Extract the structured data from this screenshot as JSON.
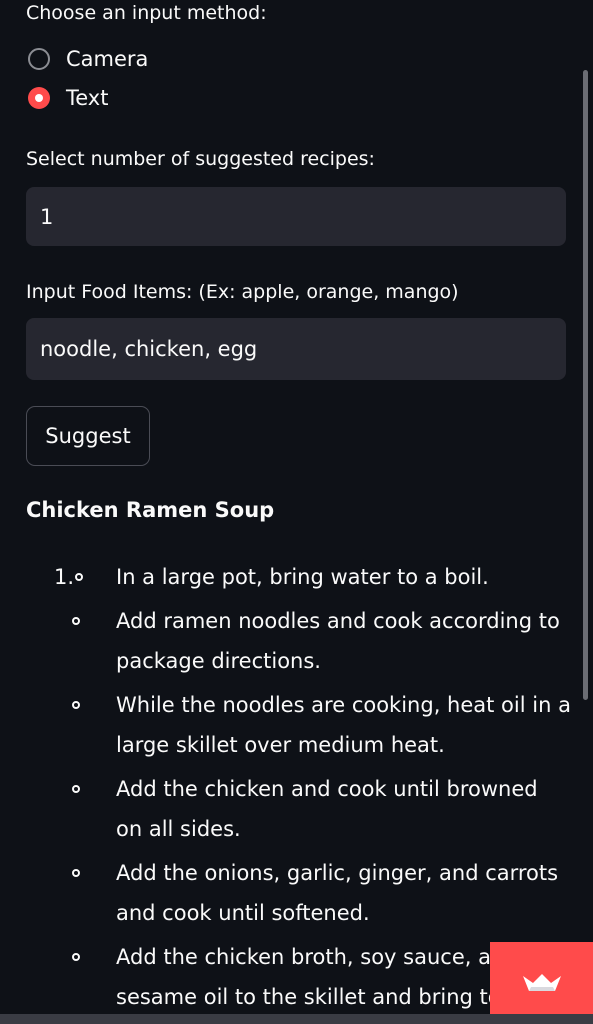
{
  "input_method": {
    "label": "Choose an input method:",
    "options": [
      {
        "label": "Camera",
        "selected": false
      },
      {
        "label": "Text",
        "selected": true
      }
    ]
  },
  "recipes_count": {
    "label": "Select number of suggested recipes:",
    "value": "1"
  },
  "food_items": {
    "label": "Input Food Items: (Ex: apple, orange, mango)",
    "value": "noodle, chicken, egg"
  },
  "suggest_button": {
    "label": "Suggest"
  },
  "recipe": {
    "title": "Chicken Ramen Soup",
    "number_marker": "1.",
    "steps": [
      [
        "In a large pot, bring water to a boil."
      ],
      [
        "Add ramen noodles and cook according to",
        "package directions."
      ],
      [
        "While the noodles are cooking, heat oil in a",
        "large skillet over medium heat."
      ],
      [
        "Add the chicken and cook until browned",
        "on all sides."
      ],
      [
        "Add the onions, garlic, ginger, and carrots",
        "and cook until softened."
      ],
      [
        "Add the chicken broth, soy sauce, and",
        "sesame oil to the skillet and bring to"
      ]
    ]
  },
  "colors": {
    "background": "#0e1117",
    "accent": "#ff4b4b",
    "input_bg": "#262730"
  },
  "icons": {
    "badge": "streamlit-crown-icon"
  }
}
